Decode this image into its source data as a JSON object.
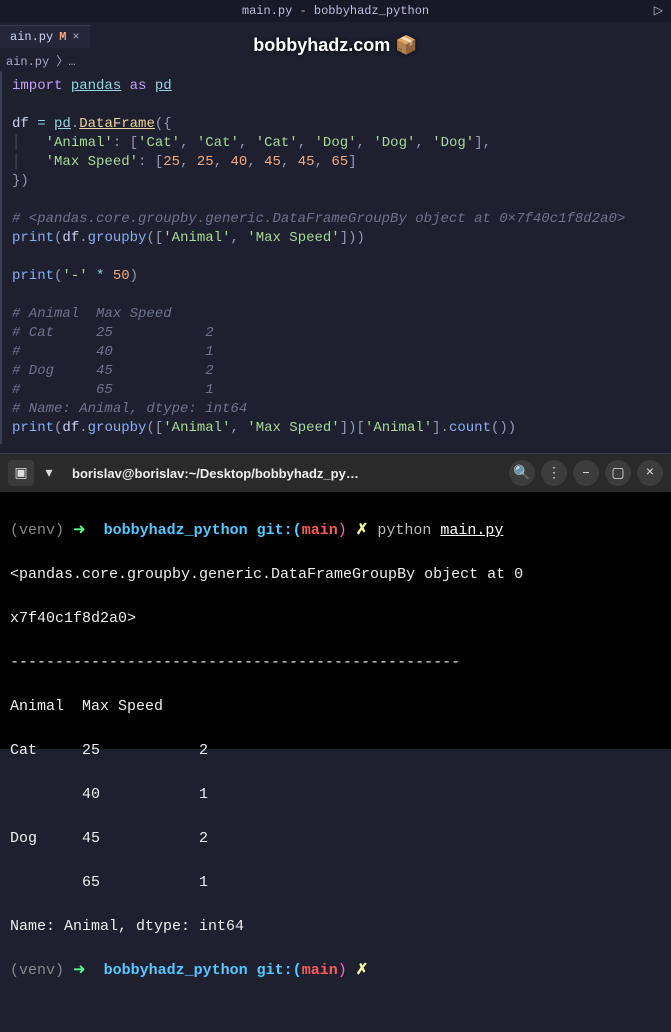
{
  "window": {
    "title": "main.py - bobbyhadz_python",
    "right_arrow": "▷"
  },
  "tab": {
    "filename": "ain.py",
    "modified": "M",
    "close": "×"
  },
  "watermark": {
    "text": "bobbyhadz.com 📦"
  },
  "breadcrumb": {
    "text": "ain.py 〉…"
  },
  "code": {
    "l1_import": "import",
    "l1_pandas": "pandas",
    "l1_as": "as",
    "l1_pd": "pd",
    "l3_df": "df",
    "l3_eq": " = ",
    "l3_pd": "pd",
    "l3_dot": ".",
    "l3_DataFrame": "DataFrame",
    "l3_open": "({",
    "l4_key": "'Animal'",
    "l4_colon": ": [",
    "l4_v1": "'Cat'",
    "l4_v2": "'Cat'",
    "l4_v3": "'Cat'",
    "l4_v4": "'Dog'",
    "l4_v5": "'Dog'",
    "l4_v6": "'Dog'",
    "l4_close": "],",
    "l5_key": "'Max Speed'",
    "l5_colon": ": [",
    "l5_v1": "25",
    "l5_v2": "25",
    "l5_v3": "40",
    "l5_v4": "45",
    "l5_v5": "45",
    "l5_v6": "65",
    "l5_close": "]",
    "l6_close": "})",
    "l8_cmt": "# <pandas.core.groupby.generic.DataFrameGroupBy object at 0×7f40c1f8d2a0>",
    "l9_print": "print",
    "l9_open": "(",
    "l9_df": "df",
    "l9_dot": ".",
    "l9_groupby": "groupby",
    "l9_open2": "([",
    "l9_s1": "'Animal'",
    "l9_s2": "'Max Speed'",
    "l9_close": "]))",
    "l11_print": "print",
    "l11_open": "(",
    "l11_str": "'-'",
    "l11_mul": " * ",
    "l11_num": "50",
    "l11_close": ")",
    "l13_cmt": "# Animal  Max Speed",
    "l14_cmt": "# Cat     25           2",
    "l15_cmt": "#         40           1",
    "l16_cmt": "# Dog     45           2",
    "l17_cmt": "#         65           1",
    "l18_cmt": "# Name: Animal, dtype: int64",
    "l19_print": "print",
    "l19_open": "(",
    "l19_df": "df",
    "l19_dot": ".",
    "l19_groupby": "groupby",
    "l19_open2": "([",
    "l19_s1": "'Animal'",
    "l19_s2": "'Max Speed'",
    "l19_close2": "])[",
    "l19_s3": "'Animal'",
    "l19_close3": "].",
    "l19_count": "count",
    "l19_close4": "())"
  },
  "terminal": {
    "title": "borislav@borislav:~/Desktop/bobbyhadz_py…",
    "venv": "(venv)",
    "arrow": "➜ ",
    "dir": "bobbyhadz_python",
    "git": "git:(",
    "branch": "main",
    "git_close": ")",
    "x": "✗",
    "cmd": "python",
    "file": "main.py",
    "out1": "<pandas.core.groupby.generic.DataFrameGroupBy object at 0",
    "out2": "x7f40c1f8d2a0>",
    "sep": "--------------------------------------------------",
    "hdr": "Animal  Max Speed",
    "r1": "Cat     25           2",
    "r2": "        40           1",
    "r3": "Dog     45           2",
    "r4": "        65           1",
    "ftr": "Name: Animal, dtype: int64"
  }
}
